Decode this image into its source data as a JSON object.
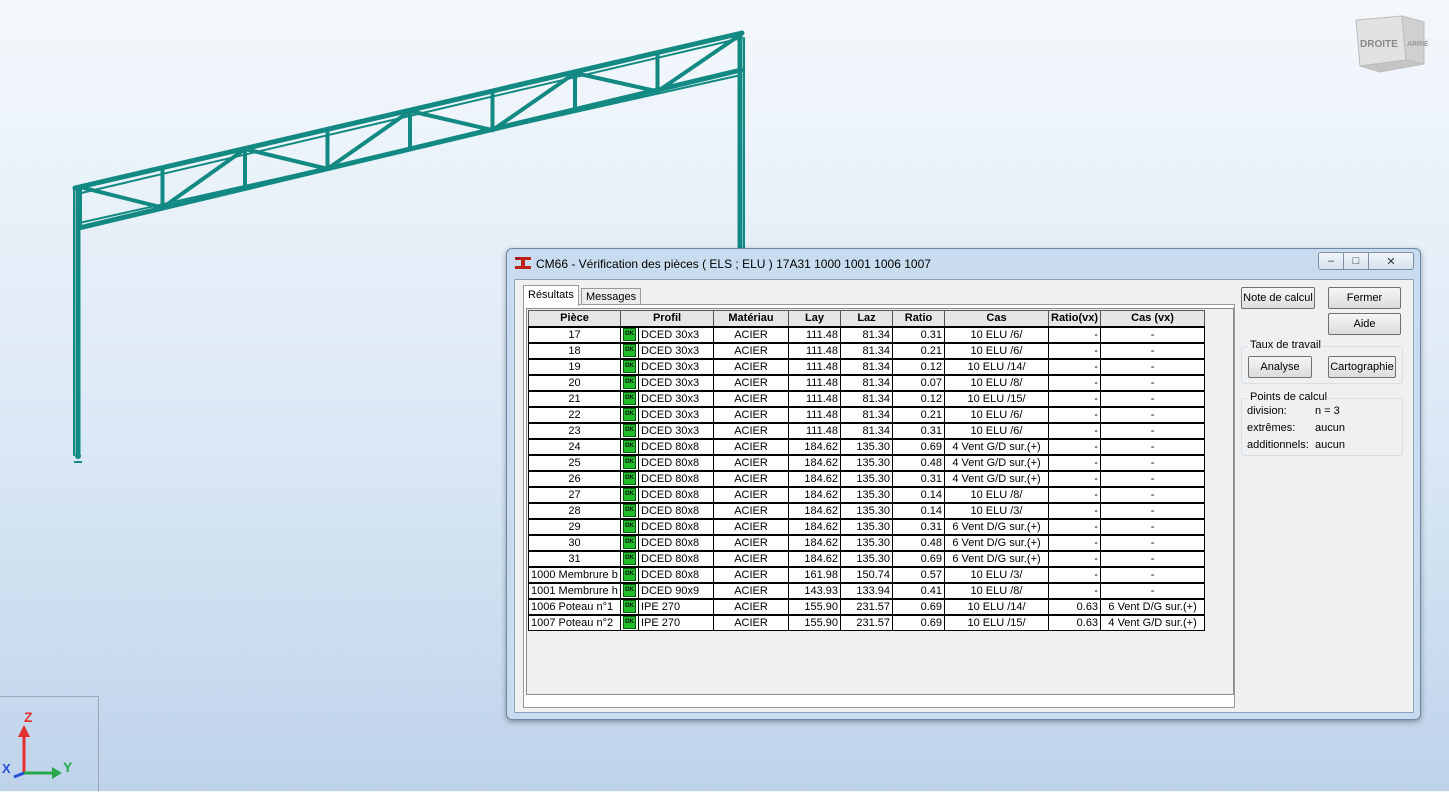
{
  "viewcube": {
    "face_label": "DROITE",
    "side_label": "ARRIÈ"
  },
  "axes": {
    "z_label": "Z",
    "y_label": "Y",
    "x_label": "X"
  },
  "colors": {
    "steel": "#128a83",
    "ok_green": "#1fbe2a",
    "axis_z": "#e53030",
    "axis_y": "#2aa84a",
    "axis_x": "#2a4fd8"
  },
  "dialog": {
    "title": "CM66 - Vérification des pièces ( ELS ; ELU ) 17A31 1000 1001 1006 1007",
    "tabs": [
      {
        "label": "Résultats",
        "active": true
      },
      {
        "label": "Messages",
        "active": false
      }
    ],
    "columns": [
      "Pièce",
      "Profil",
      "Matériau",
      "Lay",
      "Laz",
      "Ratio",
      "Cas",
      "Ratio(vx)",
      "Cas (vx)"
    ],
    "status_icon_label": "OK",
    "rows": [
      {
        "piece": "17",
        "profil": "DCED 30x3",
        "materiau": "ACIER",
        "lay": "111.48",
        "laz": "81.34",
        "ratio": "0.31",
        "cas": "10 ELU /6/",
        "ratio_vx": "-",
        "cas_vx": "-"
      },
      {
        "piece": "18",
        "profil": "DCED 30x3",
        "materiau": "ACIER",
        "lay": "111.48",
        "laz": "81.34",
        "ratio": "0.21",
        "cas": "10 ELU /6/",
        "ratio_vx": "-",
        "cas_vx": "-"
      },
      {
        "piece": "19",
        "profil": "DCED 30x3",
        "materiau": "ACIER",
        "lay": "111.48",
        "laz": "81.34",
        "ratio": "0.12",
        "cas": "10 ELU /14/",
        "ratio_vx": "-",
        "cas_vx": "-"
      },
      {
        "piece": "20",
        "profil": "DCED 30x3",
        "materiau": "ACIER",
        "lay": "111.48",
        "laz": "81.34",
        "ratio": "0.07",
        "cas": "10 ELU /8/",
        "ratio_vx": "-",
        "cas_vx": "-"
      },
      {
        "piece": "21",
        "profil": "DCED 30x3",
        "materiau": "ACIER",
        "lay": "111.48",
        "laz": "81.34",
        "ratio": "0.12",
        "cas": "10 ELU /15/",
        "ratio_vx": "-",
        "cas_vx": "-"
      },
      {
        "piece": "22",
        "profil": "DCED 30x3",
        "materiau": "ACIER",
        "lay": "111.48",
        "laz": "81.34",
        "ratio": "0.21",
        "cas": "10 ELU /6/",
        "ratio_vx": "-",
        "cas_vx": "-"
      },
      {
        "piece": "23",
        "profil": "DCED 30x3",
        "materiau": "ACIER",
        "lay": "111.48",
        "laz": "81.34",
        "ratio": "0.31",
        "cas": "10 ELU /6/",
        "ratio_vx": "-",
        "cas_vx": "-"
      },
      {
        "piece": "24",
        "profil": "DCED 80x8",
        "materiau": "ACIER",
        "lay": "184.62",
        "laz": "135.30",
        "ratio": "0.69",
        "cas": "4 Vent G/D sur.(+)",
        "ratio_vx": "-",
        "cas_vx": "-"
      },
      {
        "piece": "25",
        "profil": "DCED 80x8",
        "materiau": "ACIER",
        "lay": "184.62",
        "laz": "135.30",
        "ratio": "0.48",
        "cas": "4 Vent G/D sur.(+)",
        "ratio_vx": "-",
        "cas_vx": "-"
      },
      {
        "piece": "26",
        "profil": "DCED 80x8",
        "materiau": "ACIER",
        "lay": "184.62",
        "laz": "135.30",
        "ratio": "0.31",
        "cas": "4 Vent G/D sur.(+)",
        "ratio_vx": "-",
        "cas_vx": "-"
      },
      {
        "piece": "27",
        "profil": "DCED 80x8",
        "materiau": "ACIER",
        "lay": "184.62",
        "laz": "135.30",
        "ratio": "0.14",
        "cas": "10 ELU /8/",
        "ratio_vx": "-",
        "cas_vx": "-"
      },
      {
        "piece": "28",
        "profil": "DCED 80x8",
        "materiau": "ACIER",
        "lay": "184.62",
        "laz": "135.30",
        "ratio": "0.14",
        "cas": "10 ELU /3/",
        "ratio_vx": "-",
        "cas_vx": "-"
      },
      {
        "piece": "29",
        "profil": "DCED 80x8",
        "materiau": "ACIER",
        "lay": "184.62",
        "laz": "135.30",
        "ratio": "0.31",
        "cas": "6 Vent D/G sur.(+)",
        "ratio_vx": "-",
        "cas_vx": "-"
      },
      {
        "piece": "30",
        "profil": "DCED 80x8",
        "materiau": "ACIER",
        "lay": "184.62",
        "laz": "135.30",
        "ratio": "0.48",
        "cas": "6 Vent D/G sur.(+)",
        "ratio_vx": "-",
        "cas_vx": "-"
      },
      {
        "piece": "31",
        "profil": "DCED 80x8",
        "materiau": "ACIER",
        "lay": "184.62",
        "laz": "135.30",
        "ratio": "0.69",
        "cas": "6 Vent D/G sur.(+)",
        "ratio_vx": "-",
        "cas_vx": "-"
      },
      {
        "piece": "1000  Membrure b",
        "profil": "DCED 80x8",
        "materiau": "ACIER",
        "lay": "161.98",
        "laz": "150.74",
        "ratio": "0.57",
        "cas": "10 ELU /3/",
        "ratio_vx": "-",
        "cas_vx": "-"
      },
      {
        "piece": "1001  Membrure h",
        "profil": "DCED 90x9",
        "materiau": "ACIER",
        "lay": "143.93",
        "laz": "133.94",
        "ratio": "0.41",
        "cas": "10 ELU /8/",
        "ratio_vx": "-",
        "cas_vx": "-"
      },
      {
        "piece": "1006  Poteau n°1",
        "profil": "IPE 270",
        "materiau": "ACIER",
        "lay": "155.90",
        "laz": "231.57",
        "ratio": "0.69",
        "cas": "10 ELU /14/",
        "ratio_vx": "0.63",
        "cas_vx": "6 Vent D/G sur.(+)"
      },
      {
        "piece": "1007  Poteau n°2",
        "profil": "IPE 270",
        "materiau": "ACIER",
        "lay": "155.90",
        "laz": "231.57",
        "ratio": "0.69",
        "cas": "10 ELU /15/",
        "ratio_vx": "0.63",
        "cas_vx": "4 Vent G/D sur.(+)"
      }
    ],
    "buttons": {
      "note": "Note de calcul",
      "fermer": "Fermer",
      "aide": "Aide",
      "analyse": "Analyse",
      "cartographie": "Cartographie"
    },
    "taux": {
      "label": "Taux de travail"
    },
    "points": {
      "label": "Points de calcul",
      "division_label": "division:",
      "division_value": "n = 3",
      "extremes_label": "extrêmes:",
      "extremes_value": "aucun",
      "additionnels_label": "additionnels:",
      "additionnels_value": "aucun"
    }
  }
}
